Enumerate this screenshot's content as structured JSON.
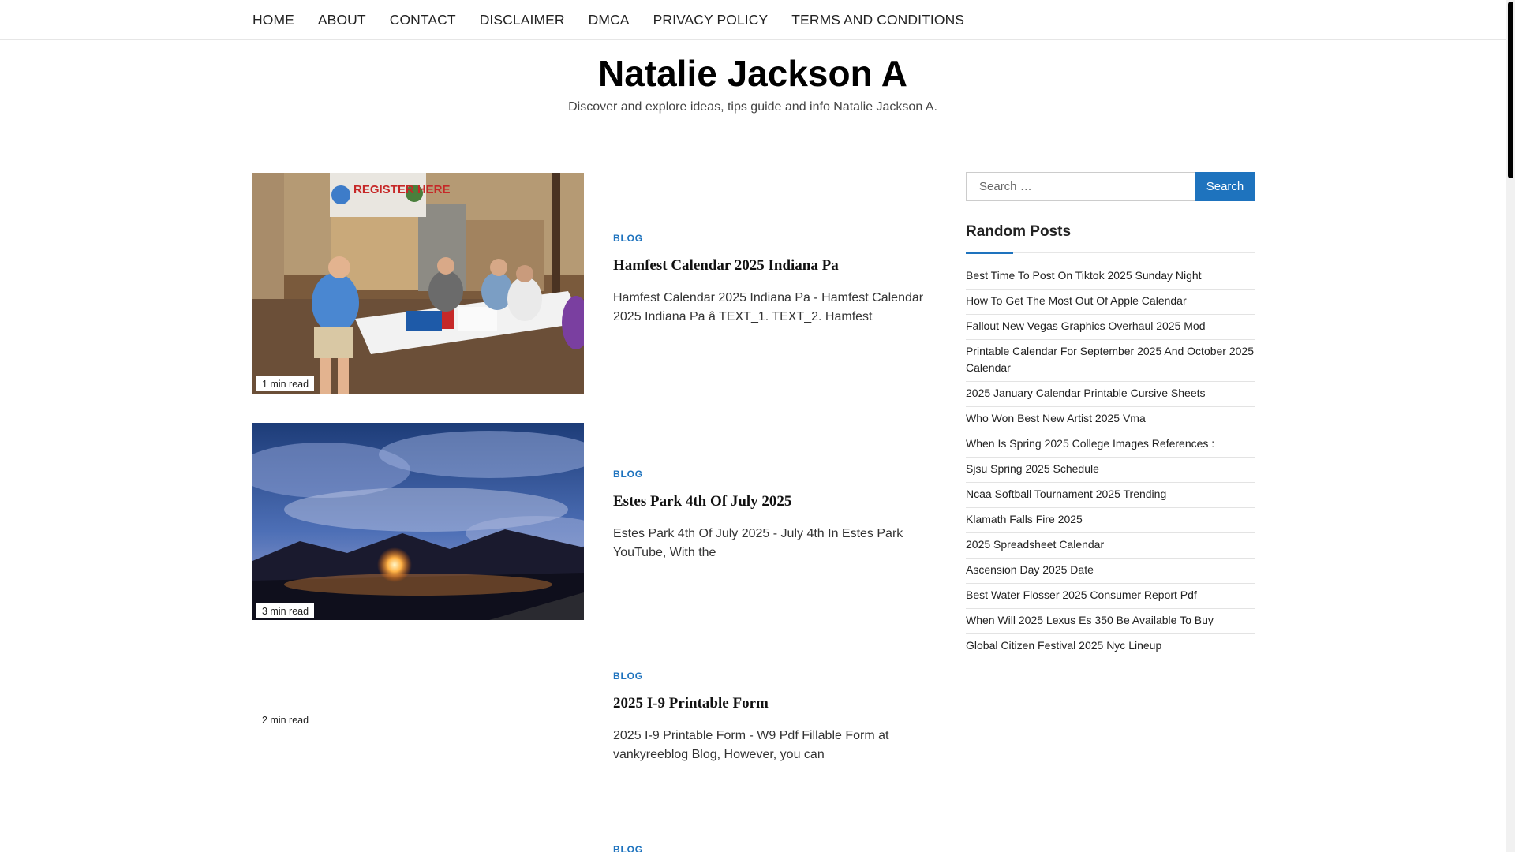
{
  "nav": {
    "items": [
      "HOME",
      "ABOUT",
      "CONTACT",
      "DISCLAIMER",
      "DMCA",
      "PRIVACY POLICY",
      "TERMS AND CONDITIONS"
    ]
  },
  "header": {
    "title": "Natalie Jackson A",
    "description": "Discover and explore ideas, tips guide and info Natalie Jackson A."
  },
  "posts": [
    {
      "category": "BLOG",
      "title": "Hamfest Calendar 2025 Indiana Pa",
      "excerpt": "Hamfest Calendar 2025 Indiana Pa - Hamfest Calendar 2025 Indiana Pa â TEXT_1. TEXT_2. Hamfest",
      "read_time": "1 min read",
      "image_text": "REGISTER HERE"
    },
    {
      "category": "BLOG",
      "title": "Estes Park 4th Of July 2025",
      "excerpt": "Estes Park 4th Of July 2025 - July 4th In Estes Park YouTube, With the",
      "read_time": "3 min read"
    },
    {
      "category": "BLOG",
      "title": "2025 I-9 Printable Form",
      "excerpt": "2025 I-9 Printable Form - W9 Pdf Fillable Form at vankyreeblog Blog, However, you can",
      "read_time": "2 min read"
    },
    {
      "category": "BLOG"
    }
  ],
  "sidebar": {
    "search_placeholder": "Search …",
    "search_button": "Search",
    "widget_title": "Random Posts",
    "random_posts": [
      "Best Time To Post On Tiktok 2025 Sunday Night",
      "How To Get The Most Out Of Apple Calendar",
      "Fallout New Vegas Graphics Overhaul 2025 Mod",
      "Printable Calendar For September 2025 And October 2025 Calendar",
      "2025 January Calendar Printable Cursive Sheets",
      "Who Won Best New Artist 2025 Vma",
      "When Is Spring 2025 College Images References :",
      "Sjsu Spring 2025 Schedule",
      "Ncaa Softball Tournament 2025 Trending",
      "Klamath Falls Fire 2025",
      "2025 Spreadsheet Calendar",
      "Ascension Day 2025 Date",
      "Best Water Flosser 2025 Consumer Report Pdf",
      "When Will 2025 Lexus Es 350 Be Available To Buy",
      "Global Citizen Festival 2025 Nyc Lineup"
    ]
  },
  "colors": {
    "accent": "#1e73be",
    "text": "#222222",
    "border": "#e6e6e6"
  }
}
